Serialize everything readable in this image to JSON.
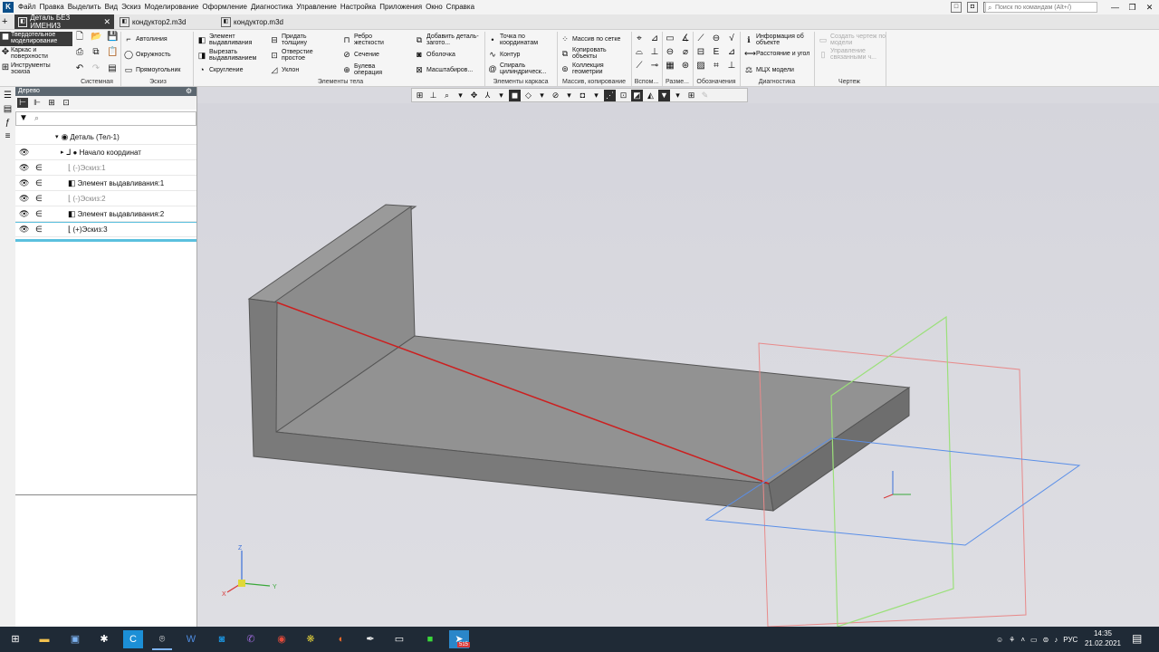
{
  "menubar": {
    "logo": "K",
    "items": [
      "Файл",
      "Правка",
      "Выделить",
      "Вид",
      "Эскиз",
      "Моделирование",
      "Оформление",
      "Диагностика",
      "Управление",
      "Настройка",
      "Приложения",
      "Окно",
      "Справка"
    ],
    "search_placeholder": "Поиск по командам (Alt+/)",
    "window_controls": [
      "—",
      "❐",
      "✕"
    ]
  },
  "tabs": [
    {
      "label": "Деталь БЕЗ ИМЕНИ3",
      "active": true
    },
    {
      "label": "кондуктор2.m3d",
      "active": false
    },
    {
      "label": "кондуктор.m3d",
      "active": false
    }
  ],
  "ribbon": {
    "modes": [
      "Твердотельное моделирование",
      "Каркас и поверхности",
      "Инструменты эскиза"
    ],
    "sistemnaya": {
      "label": "Системная"
    },
    "eskiz": {
      "label": "Эскиз",
      "cmds": [
        "Автолиния",
        "Окружность",
        "Прямоугольник"
      ]
    },
    "elementy_tela": {
      "label": "Элементы тела",
      "cmds": [
        "Элемент выдавливания",
        "Вырезать выдавливанием",
        "Скругление",
        "Придать толщину",
        "Отверстие простое",
        "Уклон",
        "Ребро жесткости",
        "Сечение",
        "Булева операция",
        "Добавить деталь-загото...",
        "Оболочка",
        "Масштабиров..."
      ]
    },
    "elementy_karkasa": {
      "label": "Элементы каркаса",
      "cmds": [
        "Точка по координатам",
        "Контур",
        "Спираль цилиндрическ..."
      ]
    },
    "massivy": {
      "label": "Массив, копирование",
      "cmds": [
        "Массив по сетке",
        "Копировать объекты",
        "Коллекция геометрии"
      ]
    },
    "vspom": {
      "label": "Вспом..."
    },
    "razm": {
      "label": "Разме..."
    },
    "oboznacheniya": {
      "label": "Обозначения"
    },
    "diagnostika": {
      "label": "Диагностика",
      "cmds": [
        "Информация об объекте",
        "Расстояние и угол",
        "МЦХ модели"
      ]
    },
    "chertezh": {
      "label": "Чертеж",
      "cmds": [
        "Создать чертеж по модели",
        "Управление связанными ч..."
      ]
    }
  },
  "tree": {
    "title": "Дерево",
    "filter_placeholder": "",
    "rows": [
      {
        "label": "Деталь (Тел-1)",
        "icon": "part-icon",
        "eye": false,
        "rel": false,
        "dim": false,
        "indent": 44
      },
      {
        "label": "● Начало координат",
        "icon": "origin-icon",
        "eye": true,
        "rel": false,
        "dim": false,
        "indent": 52
      },
      {
        "label": "(-)Эскиз:1",
        "icon": "sketch-icon",
        "eye": true,
        "rel": true,
        "dim": true,
        "indent": 58
      },
      {
        "label": "Элемент выдавливания:1",
        "icon": "extrude-icon",
        "eye": true,
        "rel": true,
        "dim": false,
        "indent": 58
      },
      {
        "label": "(-)Эскиз:2",
        "icon": "sketch-icon",
        "eye": true,
        "rel": true,
        "dim": true,
        "indent": 58
      },
      {
        "label": "Элемент выдавливания:2",
        "icon": "extrude-icon",
        "eye": true,
        "rel": true,
        "dim": false,
        "indent": 58
      },
      {
        "label": "(+)Эскиз:3",
        "icon": "sketch-icon",
        "eye": true,
        "rel": true,
        "dim": false,
        "indent": 58
      }
    ]
  },
  "axis_labels": {
    "z": "Z",
    "x": "X",
    "y": "Y"
  },
  "taskbar": {
    "clock_time": "14:35",
    "clock_date": "21.02.2021",
    "language": "РУС",
    "badge": "515"
  },
  "colors": {
    "accent_dark": "#3b3b3b",
    "model_face": "#8a8a8a",
    "edge_red": "#cc1f1f",
    "plane_red": "#e88a8a",
    "plane_green": "#9be07a",
    "plane_blue": "#5a8fe8"
  }
}
